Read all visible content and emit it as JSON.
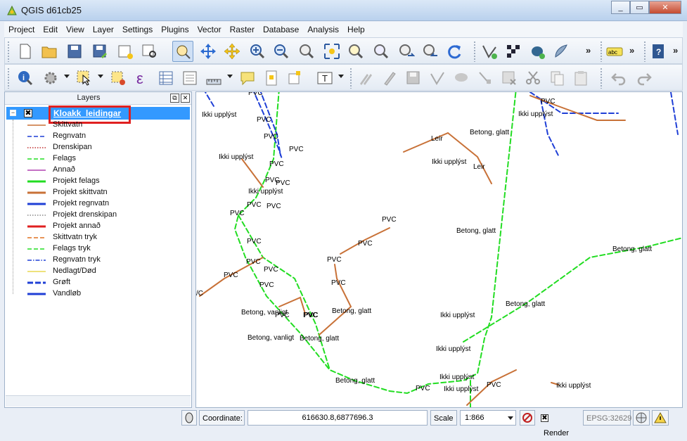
{
  "window": {
    "title": "QGIS d61cb25",
    "minimize": "_",
    "maximize": "▭",
    "close": "✕"
  },
  "menu": [
    "Project",
    "Edit",
    "View",
    "Layer",
    "Settings",
    "Plugins",
    "Vector",
    "Raster",
    "Database",
    "Analysis",
    "Help"
  ],
  "toolbar": {
    "overflow": "»",
    "label_icon_text": "abc"
  },
  "layers_panel": {
    "title": "Layers",
    "float_button": "⧉",
    "close_button": "✕",
    "layer": {
      "name": "Kloakk_leidingar",
      "expander": "−",
      "checked": "✖"
    },
    "legend": [
      {
        "label": "Skittvatn",
        "color": "#c87137",
        "style": "solid"
      },
      {
        "label": "Regnvatn",
        "color": "#1f3fd6",
        "style": "dash"
      },
      {
        "label": "Drenskipan",
        "color": "#c03030",
        "style": "dot"
      },
      {
        "label": "Felags",
        "color": "#22dd22",
        "style": "dash"
      },
      {
        "label": "Annað",
        "color": "#b040b0",
        "style": "solid"
      },
      {
        "label": "Projekt felags",
        "color": "#22dd22",
        "style": "thick"
      },
      {
        "label": "Projekt skittvatn",
        "color": "#c87137",
        "style": "thick"
      },
      {
        "label": "Projekt regnvatn",
        "color": "#1f3fd6",
        "style": "thick"
      },
      {
        "label": "Projekt drenskipan",
        "color": "#888888",
        "style": "dot"
      },
      {
        "label": "Projekt annað",
        "color": "#e02020",
        "style": "thick"
      },
      {
        "label": "Skittvatn tryk",
        "color": "#e07020",
        "style": "dash"
      },
      {
        "label": "Felags tryk",
        "color": "#22dd22",
        "style": "dash"
      },
      {
        "label": "Regnvatn tryk",
        "color": "#1f3fd6",
        "style": "dashdot"
      },
      {
        "label": "Nedlagt/Død",
        "color": "#e8d850",
        "style": "solid"
      },
      {
        "label": "Grøft",
        "color": "#1f3fd6",
        "style": "thickdash"
      },
      {
        "label": "Vandløb",
        "color": "#1f3fd6",
        "style": "thick"
      }
    ]
  },
  "map_labels": [
    "PVC",
    "Ikki upplýst",
    "PVC",
    "PVC",
    "PVC",
    "PVC",
    "Leir",
    "Betong, glatt",
    "PVC",
    "Ikki upplýst",
    "PVC",
    "PVC",
    "PVC",
    "PVC",
    "PVC",
    "Ikki upplýst",
    "PVC",
    "Ikki upplýst",
    "Leir",
    "Ikki upplýst",
    "PVC",
    "PVC",
    "PVC",
    "Betong, glatt",
    "PVC",
    "Betong, glatt",
    "PVC",
    "PVC",
    "PVC",
    "PVC",
    "PVC",
    "PVC",
    "Betong, vanligt",
    "Betong, glatt",
    "PVC",
    "Betong, glatt",
    "Ikki upplýst",
    "Betong, vanligt",
    "Betong, glatt",
    "Ikki upplýst",
    "Ikki upplýst",
    "Betong, glatt",
    "PVC",
    "Ikki upplýst",
    "PVC",
    "Ikki upplýst",
    "/C"
  ],
  "status": {
    "coordinate_label": "Coordinate:",
    "coordinate_value": "616630.8,6877696.3",
    "scale_label": "Scale",
    "scale_value": "1:866",
    "render_label": "Render",
    "render_checked": "✖",
    "crs": "EPSG:32629"
  }
}
